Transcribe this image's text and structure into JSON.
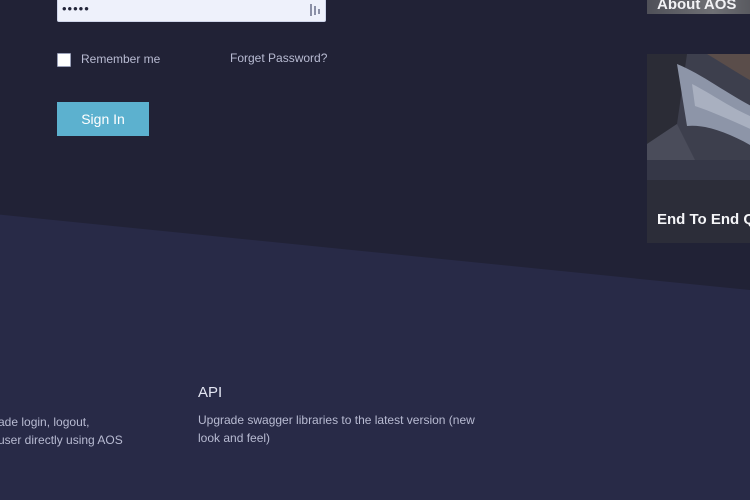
{
  "login": {
    "password_value": "•••••",
    "remember_label": "Remember me",
    "forgot_label": "Forget Password?",
    "signin_label": "Sign In"
  },
  "cards": {
    "about_title": "About AOS",
    "e2e_title": "End To End Q"
  },
  "features": {
    "left_line1": "ade login, logout,",
    "left_line2": "user directly using AOS",
    "api_title": "API",
    "api_desc": "Upgrade swagger libraries to the latest version (new look and feel)"
  },
  "colors": {
    "background": "#282a47",
    "band": "#212236",
    "accent": "#5cb1cf"
  },
  "icons": {
    "reveal": "password-reveal-icon",
    "checkbox": "checkbox-unchecked"
  }
}
